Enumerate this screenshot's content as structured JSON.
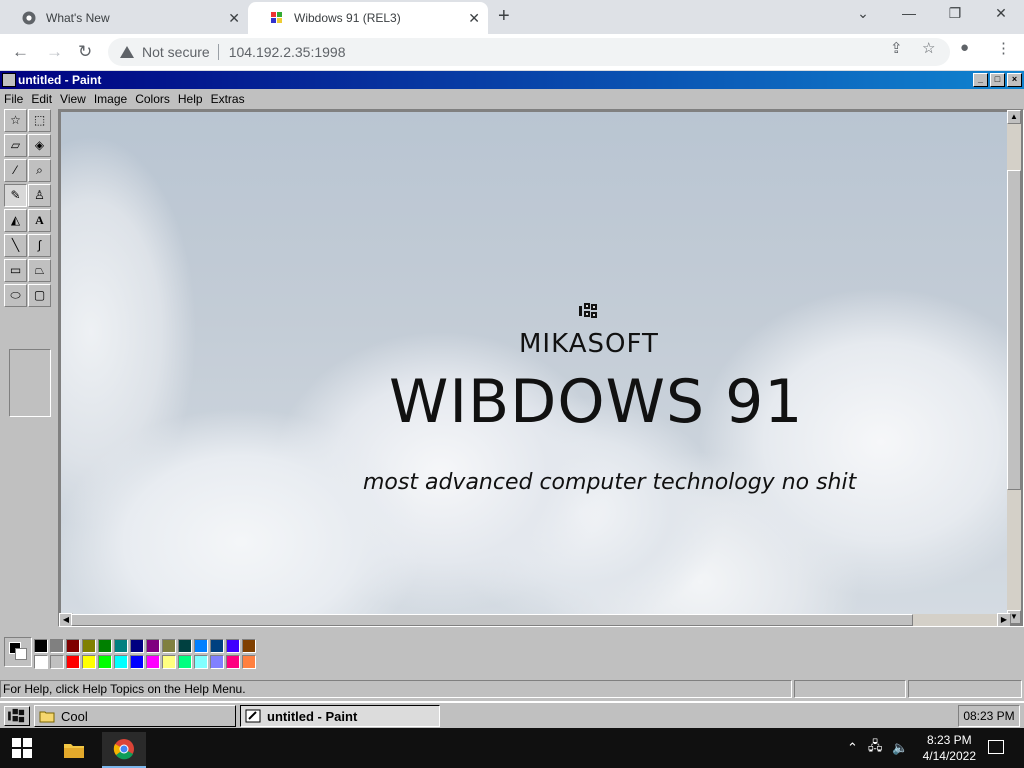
{
  "browser": {
    "tabs": [
      {
        "title": "What's New"
      },
      {
        "title": "Wibdows 91 (REL3)"
      }
    ],
    "security_label": "Not secure",
    "url": "104.192.2.35:1998"
  },
  "paint": {
    "title": "untitled - Paint",
    "menus": [
      "File",
      "Edit",
      "View",
      "Image",
      "Colors",
      "Help",
      "Extras"
    ],
    "tools": [
      "free-form-select",
      "select",
      "eraser",
      "fill-with-color",
      "pick-color",
      "magnifier",
      "pencil",
      "brush",
      "airbrush",
      "text",
      "line",
      "curve",
      "rectangle",
      "polygon",
      "ellipse",
      "rounded-rectangle"
    ],
    "active_tool": "pencil",
    "canvas": {
      "brand": "MIKASOFT",
      "product": "WIBDOWS 91",
      "slogan": "most advanced computer technology no shit"
    },
    "palette_top": [
      "#000000",
      "#808080",
      "#800000",
      "#808000",
      "#008000",
      "#008080",
      "#000080",
      "#800080",
      "#808040",
      "#004040",
      "#0080ff",
      "#004080",
      "#4000ff",
      "#804000"
    ],
    "palette_bottom": [
      "#ffffff",
      "#c0c0c0",
      "#ff0000",
      "#ffff00",
      "#00ff00",
      "#00ffff",
      "#0000ff",
      "#ff00ff",
      "#ffff80",
      "#00ff80",
      "#80ffff",
      "#8080ff",
      "#ff0080",
      "#ff8040"
    ],
    "status_text": "For Help, click Help Topics on the Help Menu."
  },
  "w9taskbar": {
    "tasks": [
      {
        "label": "Cool"
      },
      {
        "label": "untitled - Paint"
      }
    ],
    "clock": "08:23 PM"
  },
  "w10taskbar": {
    "time": "8:23 PM",
    "date": "4/14/2022"
  }
}
